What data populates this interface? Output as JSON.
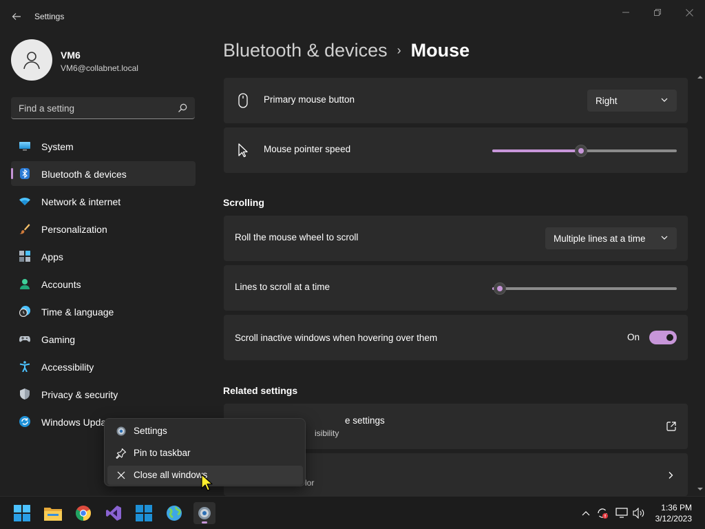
{
  "window": {
    "title": "Settings",
    "minimize_icon": "minimize-icon",
    "maximize_icon": "maximize-icon",
    "close_icon": "close-icon"
  },
  "profile": {
    "name": "VM6",
    "email": "VM6@collabnet.local"
  },
  "search": {
    "placeholder": "Find a setting"
  },
  "sidebar": {
    "items": [
      {
        "label": "System",
        "icon": "system-icon"
      },
      {
        "label": "Bluetooth & devices",
        "icon": "bluetooth-icon",
        "active": true
      },
      {
        "label": "Network & internet",
        "icon": "network-icon"
      },
      {
        "label": "Personalization",
        "icon": "brush-icon"
      },
      {
        "label": "Apps",
        "icon": "apps-icon"
      },
      {
        "label": "Accounts",
        "icon": "accounts-icon"
      },
      {
        "label": "Time & language",
        "icon": "time-language-icon"
      },
      {
        "label": "Gaming",
        "icon": "gaming-icon"
      },
      {
        "label": "Accessibility",
        "icon": "accessibility-icon"
      },
      {
        "label": "Privacy & security",
        "icon": "shield-icon"
      },
      {
        "label": "Windows Upda",
        "icon": "windows-update-icon"
      }
    ]
  },
  "breadcrumb": {
    "parent": "Bluetooth & devices",
    "separator": "›",
    "current": "Mouse"
  },
  "settings": {
    "primary_button": {
      "label": "Primary mouse button",
      "value": "Right"
    },
    "pointer_speed": {
      "label": "Mouse pointer speed",
      "level_fraction": 0.48
    },
    "scrolling_header": "Scrolling",
    "roll_wheel": {
      "label": "Roll the mouse wheel to scroll",
      "value": "Multiple lines at a time"
    },
    "lines_to_scroll": {
      "label": "Lines to scroll at a time",
      "level_fraction": 0.04
    },
    "scroll_inactive": {
      "label": "Scroll inactive windows when hovering over them",
      "state": "On"
    }
  },
  "related": {
    "header": "Related settings",
    "items": [
      {
        "title": "e settings",
        "subtitle": "isibility",
        "action_icon": "external-link-icon"
      },
      {
        "title": "",
        "subtitle": "lor",
        "action_icon": "chevron-right-icon"
      }
    ]
  },
  "context_menu": {
    "items": [
      {
        "label": "Settings",
        "icon": "gear-icon"
      },
      {
        "label": "Pin to taskbar",
        "icon": "pin-icon"
      },
      {
        "label": "Close all windows",
        "icon": "close-icon",
        "hover": true
      }
    ]
  },
  "taskbar": {
    "apps": [
      {
        "name": "start-icon"
      },
      {
        "name": "file-explorer-icon"
      },
      {
        "name": "chrome-icon"
      },
      {
        "name": "visual-studio-icon"
      },
      {
        "name": "store-icon"
      },
      {
        "name": "globe-icon"
      },
      {
        "name": "settings-gear-icon",
        "active": true
      }
    ],
    "clock": {
      "time": "1:36 PM",
      "date": "3/12/2023"
    }
  },
  "colors": {
    "accent": "#c796d9",
    "background": "#202020",
    "card": "#2b2b2b"
  }
}
